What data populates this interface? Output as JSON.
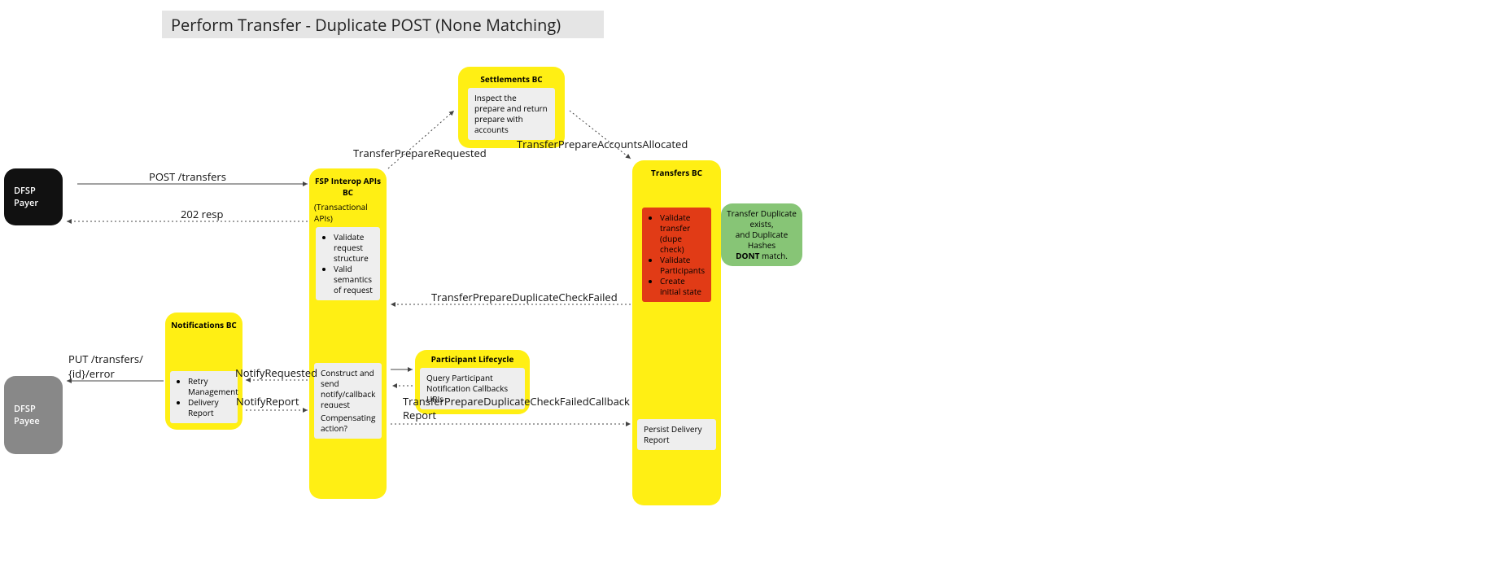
{
  "title": "Perform Transfer - Duplicate POST (None Matching)",
  "actors": {
    "payer": {
      "line1": "DFSP",
      "line2": "Payer"
    },
    "payee": {
      "line1": "DFSP",
      "line2": "Payee"
    }
  },
  "bcs": {
    "settlements": {
      "header": "Settlements BC",
      "text": "Inspect the prepare and return prepare with accounts"
    },
    "fspiop": {
      "header": "FSP Interop APIs BC",
      "subheader": "(Transactional APIs)",
      "task1_items": [
        "Validate request structure",
        "Valid semantics of request"
      ],
      "task2": "Construct and send notify/callback request",
      "task3": "Compensating action?"
    },
    "transfers": {
      "header": "Transfers BC",
      "task1_items": [
        "Validate transfer (dupe check)",
        "Validate Participants",
        "Create initial state"
      ],
      "task2": "Persist Delivery Report"
    },
    "notifications": {
      "header": "Notifications BC",
      "items": [
        "Retry Management",
        "Delivery Report"
      ]
    },
    "lifecycle": {
      "header": "Participant Lifecycle",
      "text": "Query Participant Notification Callbacks URIs"
    }
  },
  "note": {
    "line1": "Transfer Duplicate exists,",
    "line2": "and Duplicate Hashes",
    "line3b": "DONT",
    "line3": " match."
  },
  "messages": {
    "post": "POST /transfers",
    "resp": "202 resp",
    "prepReq": "TransferPrepareRequested",
    "prepAlloc": "TransferPrepareAccountsAllocated",
    "dupFail": "TransferPrepareDuplicateCheckFailed",
    "notifyReq": "NotifyRequested",
    "put": "PUT /transfers/{id}/error",
    "notifyReport": "NotifyReport",
    "callbackReport1": "TransferPrepareDuplicateCheckFailedCallback",
    "callbackReport2": "Report"
  }
}
